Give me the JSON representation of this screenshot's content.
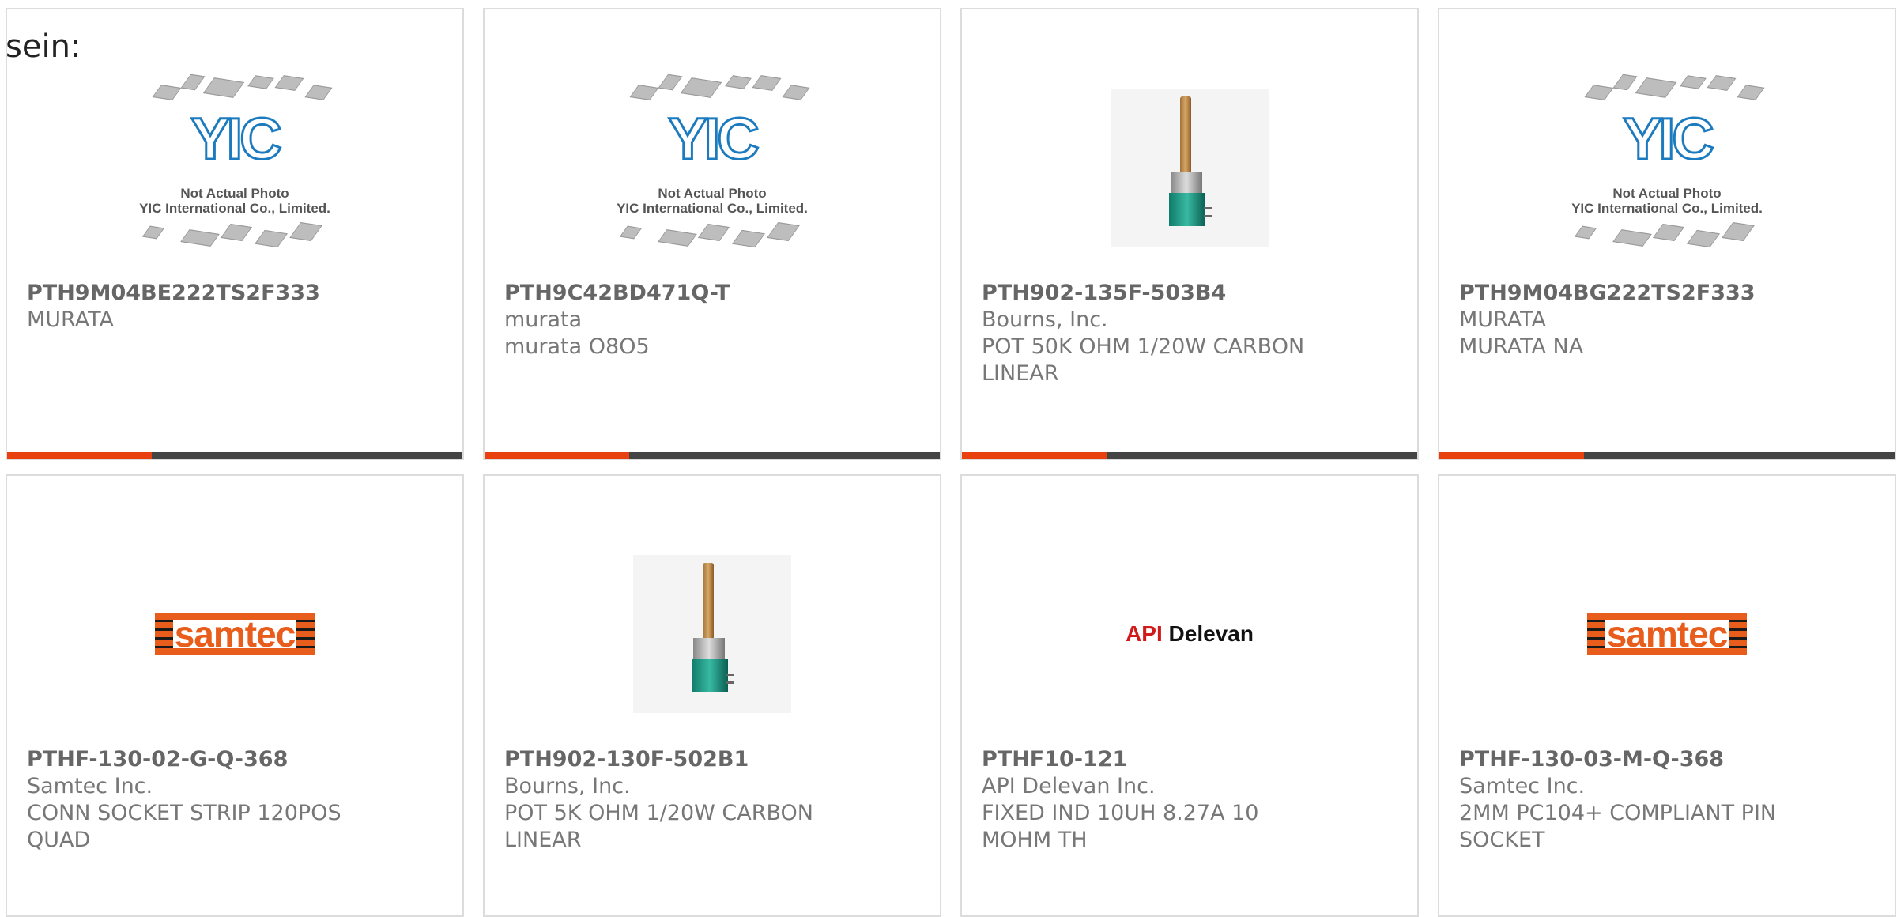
{
  "prefix_text": "sein:",
  "products": [
    {
      "part_number": "PTH9M04BE222TS2F333",
      "manufacturer": "MURATA",
      "description": "",
      "image": "yic-placeholder-image"
    },
    {
      "part_number": "PTH9C42BD471Q-T",
      "manufacturer": "murata",
      "description": "murata O8O5",
      "image": "yic-placeholder-image"
    },
    {
      "part_number": "PTH902-135F-503B4",
      "manufacturer": "Bourns, Inc.",
      "description": "POT 50K OHM 1/20W CARBON LINEAR",
      "image": "potentiometer-photo"
    },
    {
      "part_number": "PTH9M04BG222TS2F333",
      "manufacturer": "MURATA",
      "description": "MURATA NA",
      "image": "yic-placeholder-image"
    },
    {
      "part_number": "PTHF-130-02-G-Q-368",
      "manufacturer": "Samtec Inc.",
      "description": "CONN SOCKET STRIP 120POS QUAD",
      "image": "samtec-logo"
    },
    {
      "part_number": "PTH902-130F-502B1",
      "manufacturer": "Bourns, Inc.",
      "description": "POT 5K OHM 1/20W CARBON LINEAR",
      "image": "potentiometer-photo"
    },
    {
      "part_number": "PTHF10-121",
      "manufacturer": "API Delevan Inc.",
      "description": "FIXED IND 10UH 8.27A 10 MOHM TH",
      "image": "api-delevan-logo"
    },
    {
      "part_number": "PTHF-130-03-M-Q-368",
      "manufacturer": "Samtec Inc.",
      "description": "2MM PC104+ COMPLIANT PIN SOCKET",
      "image": "samtec-logo"
    }
  ],
  "placeholder": {
    "logo_text": "YIC",
    "caption_line1": "Not Actual Photo",
    "caption_line2": "YIC International Co., Limited."
  },
  "logos": {
    "samtec": "samtec",
    "api_part1": "API",
    "api_part2": "Delevan"
  },
  "colors": {
    "accent": "#e8400f",
    "bar": "#444444",
    "card_border": "#dcdcdc",
    "text": "#777777"
  }
}
